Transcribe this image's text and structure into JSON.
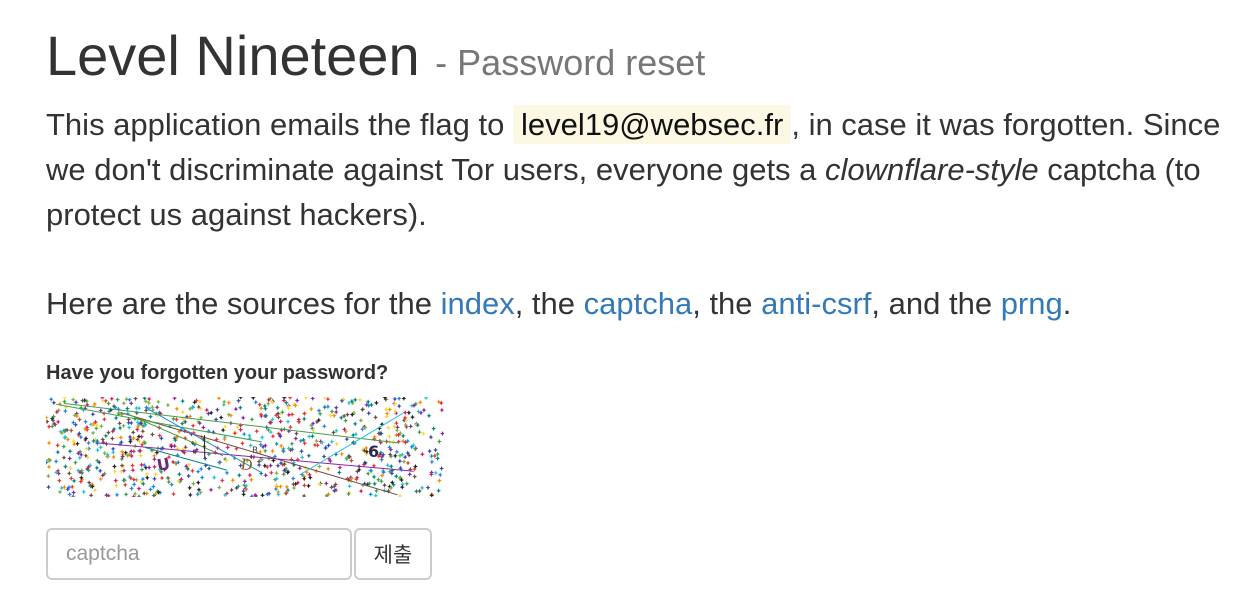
{
  "page": {
    "title": "Level Nineteen",
    "subtitle": "- Password reset"
  },
  "intro": {
    "part1": "This application emails the flag to ",
    "email": "level19@websec.fr",
    "part2": ", in case it was forgotten. Since we don't discriminate against Tor users, everyone gets a ",
    "emphasis": "clownflare-style",
    "part3": " captcha (to protect us against hackers)."
  },
  "sources": {
    "prefix": "Here are the sources for the ",
    "links": [
      "index",
      "captcha",
      "anti-csrf",
      "prng"
    ],
    "sep1": ", the ",
    "sep2": ", the ",
    "sep3": ", and the ",
    "suffix": "."
  },
  "form": {
    "label": "Have you forgotten your password?",
    "captcha_chars": [
      "U",
      "D",
      "R",
      "6"
    ],
    "input_placeholder": "captcha",
    "input_value": "",
    "submit_label": "제출"
  },
  "colors": {
    "link": "#337ab7",
    "code_background": "#fcf8e3",
    "text": "#333333",
    "subtitle": "#777777"
  }
}
